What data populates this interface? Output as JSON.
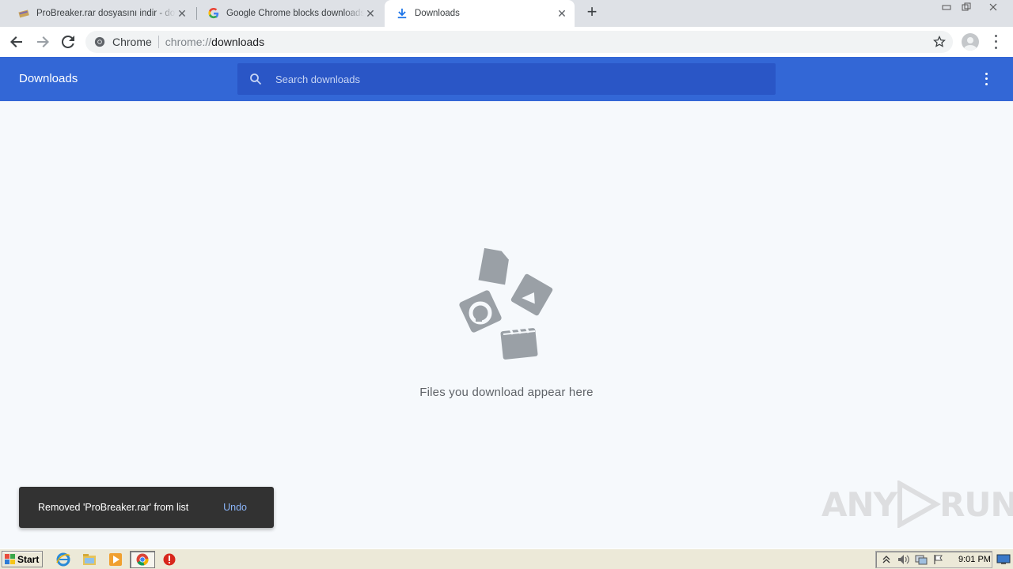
{
  "tabs": [
    {
      "title": "ProBreaker.rar dosyasını indir - download",
      "icon": "archive-icon",
      "active": false
    },
    {
      "title": "Google Chrome blocks downloads - Google",
      "icon": "google-g-icon",
      "active": false
    },
    {
      "title": "Downloads",
      "icon": "download-arrow-icon",
      "active": true
    }
  ],
  "omnibox": {
    "scheme_label": "Chrome",
    "url_prefix": "chrome://",
    "url_host": "downloads"
  },
  "downloads": {
    "title": "Downloads",
    "search_placeholder": "Search downloads",
    "empty_text": "Files you download appear here"
  },
  "toast": {
    "message": "Removed 'ProBreaker.rar' from list",
    "undo_label": "Undo"
  },
  "watermark": {
    "left": "ANY",
    "right": "RUN"
  },
  "taskbar": {
    "start_label": "Start",
    "clock": "9:01 PM"
  },
  "colors": {
    "header_blue": "#3367d6",
    "search_blue": "#2a56c6",
    "toast_bg": "#323232",
    "undo_link": "#8ab4f8"
  }
}
